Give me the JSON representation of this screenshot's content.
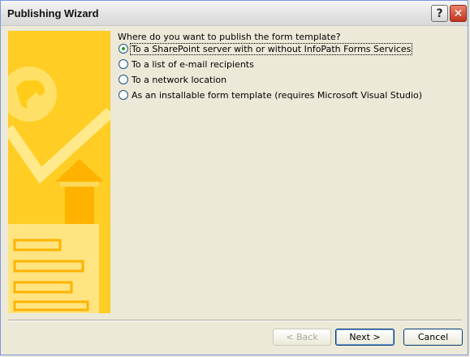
{
  "window": {
    "title": "Publishing Wizard"
  },
  "titlebar": {
    "help_glyph": "?",
    "close_glyph": "✕"
  },
  "main": {
    "question": "Where do you want to publish the form template?",
    "options": [
      {
        "label": "To a SharePoint server with or without InfoPath Forms Services",
        "selected": true
      },
      {
        "label": "To a list of e-mail recipients",
        "selected": false
      },
      {
        "label": "To a network location",
        "selected": false
      },
      {
        "label": "As an installable form template (requires Microsoft Visual Studio)",
        "selected": false
      }
    ]
  },
  "footer": {
    "back_label": "< Back",
    "next_label": "Next >",
    "cancel_label": "Cancel"
  },
  "colors": {
    "sidebar": "#ffd12a",
    "selected_dot": "#21a121"
  }
}
